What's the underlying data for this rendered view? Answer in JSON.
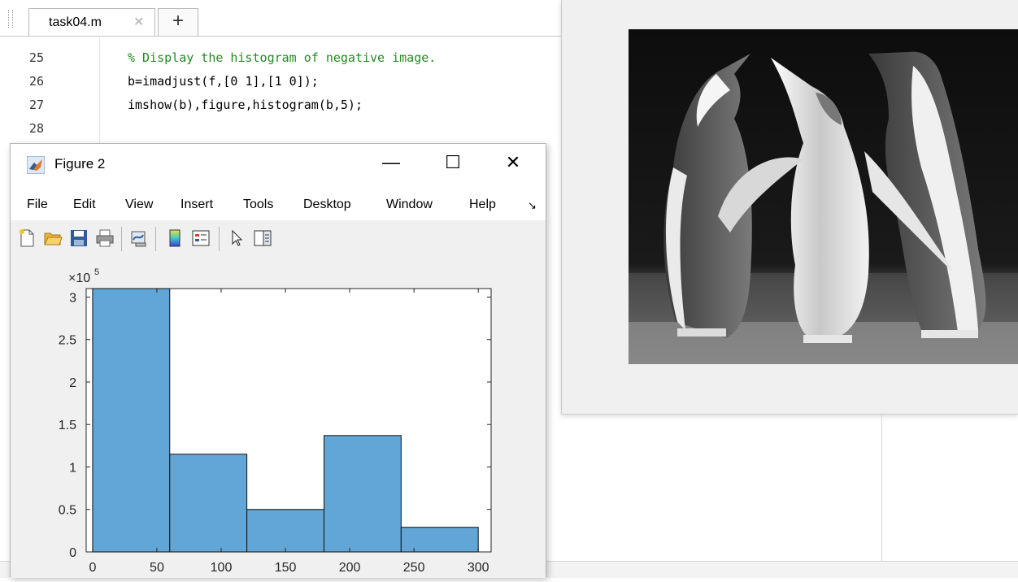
{
  "editor": {
    "tab_label": "task04.m",
    "tab_close": "✕",
    "tab_add": "+",
    "lines": [
      {
        "num": "25",
        "code": "% Display the histogram of negative image.",
        "comment": true
      },
      {
        "num": "26",
        "code": "b=imadjust(f,[0 1],[1 0]);",
        "comment": false
      },
      {
        "num": "27",
        "code": "imshow(b),figure,histogram(b,5);",
        "comment": false
      },
      {
        "num": "28",
        "code": "",
        "comment": false
      }
    ]
  },
  "figure_window": {
    "title": "Figure 2",
    "minimize": "—",
    "maximize": "☐",
    "close": "✕",
    "menu": [
      "File",
      "Edit",
      "View",
      "Insert",
      "Tools",
      "Desktop",
      "Window",
      "Help"
    ],
    "menu_overflow": "↘",
    "toolbar_icons": [
      "new-figure-icon",
      "open-file-icon",
      "save-icon",
      "print-icon",
      "link-plot-icon",
      "colorbar-icon",
      "legend-icon",
      "pointer-icon",
      "property-editor-icon"
    ]
  },
  "image_figure": {
    "image": "penguins-negative-image"
  },
  "chart_data": {
    "type": "bar",
    "title": "",
    "xlabel": "",
    "ylabel": "",
    "bin_edges": [
      0,
      60,
      120,
      180,
      240,
      300
    ],
    "values": [
      310000,
      115000,
      50000,
      137000,
      29000
    ],
    "xlim": [
      -5,
      310
    ],
    "ylim": [
      0,
      310000
    ],
    "xticks": [
      0,
      50,
      100,
      150,
      200,
      250,
      300
    ],
    "xtick_labels": [
      "0",
      "50",
      "100",
      "150",
      "200",
      "250",
      "300"
    ],
    "yticks": [
      0,
      50000,
      100000,
      150000,
      200000,
      250000,
      300000
    ],
    "ytick_labels": [
      "0",
      "0.5",
      "1",
      "1.5",
      "2",
      "2.5",
      "3"
    ],
    "exponent_label": "×10",
    "exponent_power": "5",
    "bar_color": "#61a6d6",
    "grid": false
  }
}
